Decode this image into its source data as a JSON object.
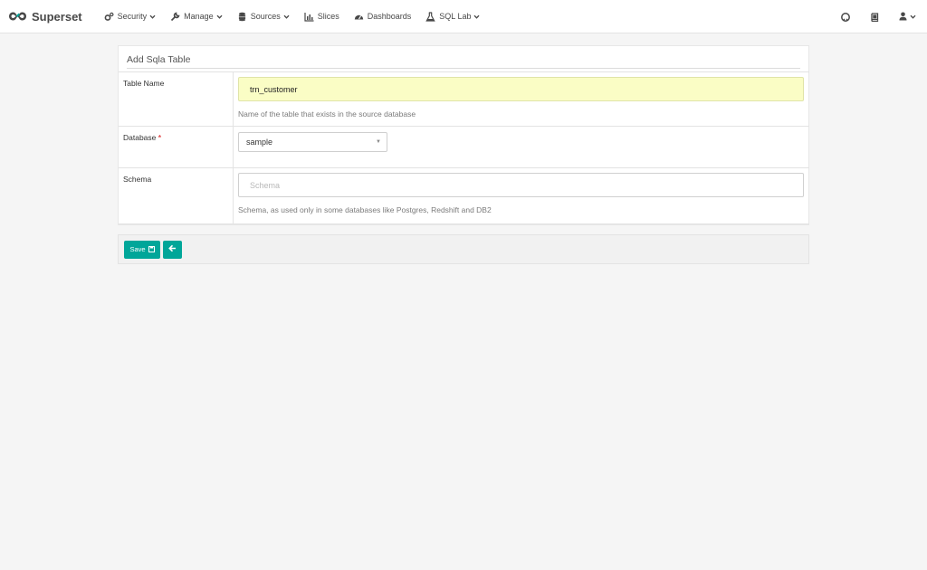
{
  "brand": {
    "name": "Superset",
    "color": "#00a699"
  },
  "nav": {
    "items": [
      {
        "label": "Security",
        "icon": "cogs-icon",
        "dropdown": true
      },
      {
        "label": "Manage",
        "icon": "wrench-icon",
        "dropdown": true
      },
      {
        "label": "Sources",
        "icon": "database-icon",
        "dropdown": true
      },
      {
        "label": "Slices",
        "icon": "bar-chart-icon",
        "dropdown": false
      },
      {
        "label": "Dashboards",
        "icon": "dashboard-icon",
        "dropdown": false
      },
      {
        "label": "SQL Lab",
        "icon": "flask-icon",
        "dropdown": true
      }
    ],
    "right": [
      {
        "icon": "github-icon"
      },
      {
        "icon": "book-icon"
      },
      {
        "icon": "user-icon",
        "dropdown": true
      }
    ]
  },
  "panel": {
    "title": "Add Sqla Table",
    "fields": {
      "table_name": {
        "label": "Table Name",
        "value": "trn_customer",
        "help": "Name of the table that exists in the source database"
      },
      "database": {
        "label": "Database",
        "required_marker": "*",
        "selected": "sample"
      },
      "schema": {
        "label": "Schema",
        "value": "",
        "placeholder": "Schema",
        "help": "Schema, as used only in some databases like Postgres, Redshift and DB2"
      }
    }
  },
  "footer": {
    "save_label": "Save",
    "accent": "#00a699"
  }
}
